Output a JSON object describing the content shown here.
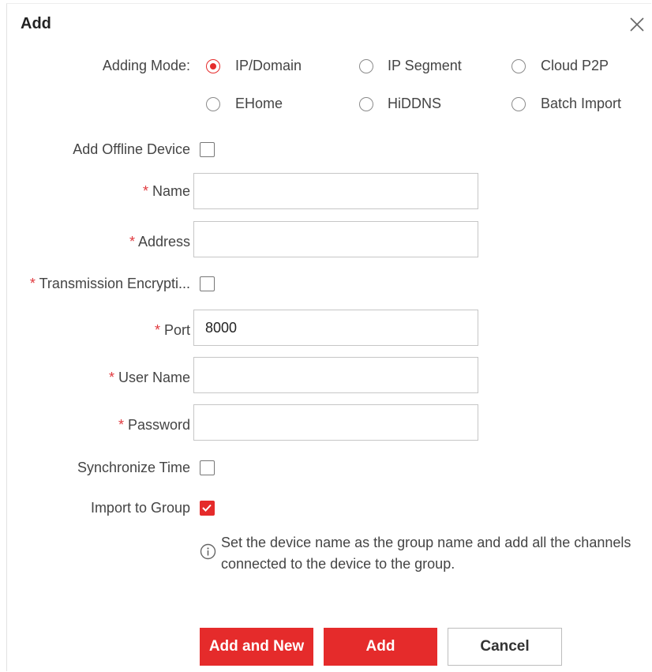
{
  "dialog": {
    "title": "Add"
  },
  "adding_mode": {
    "label": "Adding Mode:",
    "options": [
      {
        "label": "IP/Domain",
        "selected": true
      },
      {
        "label": "IP Segment",
        "selected": false
      },
      {
        "label": "Cloud P2P",
        "selected": false
      },
      {
        "label": "EHome",
        "selected": false
      },
      {
        "label": "HiDDNS",
        "selected": false
      },
      {
        "label": "Batch Import",
        "selected": false
      }
    ]
  },
  "fields": {
    "add_offline_device": {
      "label": "Add Offline Device",
      "checked": false
    },
    "name": {
      "required_mark": "* ",
      "label": "Name",
      "value": ""
    },
    "address": {
      "required_mark": "* ",
      "label": "Address",
      "value": ""
    },
    "transmission_encryption": {
      "required_mark": "* ",
      "label": "Transmission Encrypti...",
      "checked": false
    },
    "port": {
      "required_mark": "* ",
      "label": "Port",
      "value": "8000"
    },
    "user_name": {
      "required_mark": "* ",
      "label": "User Name",
      "value": ""
    },
    "password": {
      "required_mark": "* ",
      "label": "Password",
      "value": ""
    },
    "synchronize_time": {
      "label": "Synchronize Time",
      "checked": false
    },
    "import_to_group": {
      "label": "Import to Group",
      "checked": true
    }
  },
  "info": {
    "icon": "info-icon",
    "text": "Set the device name as the group name and add all the channels connected to the device to the group."
  },
  "buttons": {
    "add_and_new": "Add and New",
    "add": "Add",
    "cancel": "Cancel"
  },
  "colors": {
    "accent": "#e52b2b",
    "required": "#e0393e"
  }
}
